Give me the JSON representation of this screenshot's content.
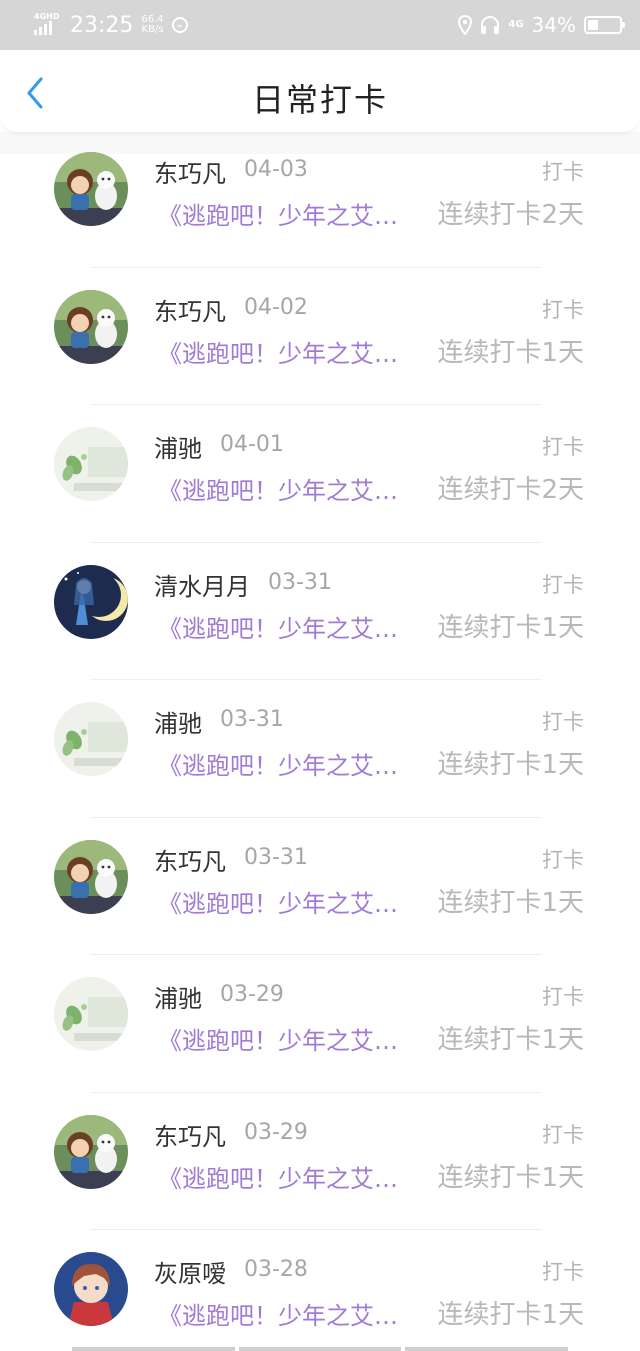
{
  "status_bar": {
    "network_label": "4GHD",
    "time": "23:25",
    "speed_value": "66.4",
    "speed_unit": "KB/s",
    "net_type": "4G",
    "battery": "34%",
    "battery_level": 0.34
  },
  "header": {
    "back_icon": "chevron-left-icon",
    "title": "日常打卡"
  },
  "records": [
    {
      "name": "东巧凡",
      "date": "04-03",
      "tag": "打卡",
      "book": "《逃跑吧！少年之艾…",
      "streak": "连续打卡2天",
      "avatar": "girl-figure"
    },
    {
      "name": "东巧凡",
      "date": "04-02",
      "tag": "打卡",
      "book": "《逃跑吧！少年之艾…",
      "streak": "连续打卡1天",
      "avatar": "girl-figure"
    },
    {
      "name": "浦驰",
      "date": "04-01",
      "tag": "打卡",
      "book": "《逃跑吧！少年之艾…",
      "streak": "连续打卡2天",
      "avatar": "leaf"
    },
    {
      "name": "清水月月",
      "date": "03-31",
      "tag": "打卡",
      "book": "《逃跑吧！少年之艾…",
      "streak": "连续打卡1天",
      "avatar": "moon"
    },
    {
      "name": "浦驰",
      "date": "03-31",
      "tag": "打卡",
      "book": "《逃跑吧！少年之艾…",
      "streak": "连续打卡1天",
      "avatar": "leaf"
    },
    {
      "name": "东巧凡",
      "date": "03-31",
      "tag": "打卡",
      "book": "《逃跑吧！少年之艾…",
      "streak": "连续打卡1天",
      "avatar": "girl-figure"
    },
    {
      "name": "浦驰",
      "date": "03-29",
      "tag": "打卡",
      "book": "《逃跑吧！少年之艾…",
      "streak": "连续打卡1天",
      "avatar": "leaf"
    },
    {
      "name": "东巧凡",
      "date": "03-29",
      "tag": "打卡",
      "book": "《逃跑吧！少年之艾…",
      "streak": "连续打卡1天",
      "avatar": "girl-figure"
    },
    {
      "name": "灰原嗳",
      "date": "03-28",
      "tag": "打卡",
      "book": "《逃跑吧！少年之艾…",
      "streak": "连续打卡1天",
      "avatar": "anime-girl"
    }
  ],
  "colors": {
    "accent": "#2f9ee8",
    "book_title": "#a17ad6",
    "muted": "#b8b8b8"
  }
}
